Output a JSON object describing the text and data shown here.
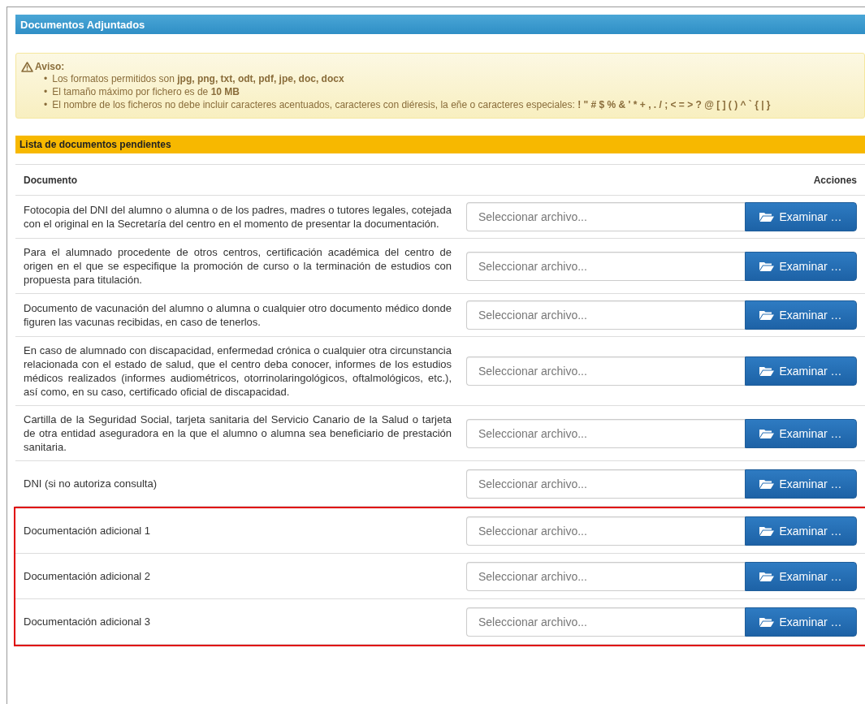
{
  "panel": {
    "title": "Documentos Adjuntados"
  },
  "notice": {
    "title": "Aviso:",
    "items": [
      {
        "bullet": "•",
        "text": "Los formatos permitidos son ",
        "emphasis": "jpg, png, txt, odt, pdf, jpe, doc, docx"
      },
      {
        "bullet": "•",
        "text": "El tamaño máximo por fichero es de ",
        "emphasis": "10 MB"
      },
      {
        "bullet": "•",
        "text": "El nombre de los ficheros no debe incluir caracteres acentuados, caracteres con diéresis, la eñe o caracteres especiales: ",
        "emphasis": "! \" # $ % & ' * + , . / ; < = > ? @ [ ] ( ) ^ ` { | }"
      }
    ]
  },
  "section": {
    "title": "Lista de documentos pendientes"
  },
  "table": {
    "columns": [
      "Documento",
      "Acciones"
    ],
    "rows": [
      {
        "document": "Fotocopia del DNI del alumno o alumna o de los padres, madres o tutores legales, cotejada con el original en la Secretaría del centro en el momento de presentar la documentación.",
        "placeholder": "Seleccionar archivo...",
        "button": "Examinar …",
        "highlighted": false
      },
      {
        "document": "Para el alumnado procedente de otros centros, certificación académica del centro de origen en el que se especifique la promoción de curso o la terminación de estudios con propuesta para titulación.",
        "placeholder": "Seleccionar archivo...",
        "button": "Examinar …",
        "highlighted": false
      },
      {
        "document": "Documento de vacunación del alumno o alumna o cualquier otro documento médico donde figuren las vacunas recibidas, en caso de tenerlos.",
        "placeholder": "Seleccionar archivo...",
        "button": "Examinar …",
        "highlighted": false
      },
      {
        "document": "En caso de alumnado con discapacidad, enfermedad crónica o cualquier otra circunstancia relacionada con el estado de salud, que el centro deba conocer, informes de los estudios médicos realizados (informes audiométricos, otorrinolaringológicos, oftalmológicos, etc.), así como, en su caso, certificado oficial de discapacidad.",
        "placeholder": "Seleccionar archivo...",
        "button": "Examinar …",
        "highlighted": false
      },
      {
        "document": "Cartilla de la Seguridad Social, tarjeta sanitaria del Servicio Canario de la Salud o tarjeta de otra entidad aseguradora en la que el alumno o alumna sea beneficiario de prestación sanitaria.",
        "placeholder": "Seleccionar archivo...",
        "button": "Examinar …",
        "highlighted": false
      },
      {
        "document": "DNI (si no autoriza consulta)",
        "placeholder": "Seleccionar archivo...",
        "button": "Examinar …",
        "highlighted": false
      },
      {
        "document": "Documentación adicional 1",
        "placeholder": "Seleccionar archivo...",
        "button": "Examinar …",
        "highlighted": true
      },
      {
        "document": "Documentación adicional 2",
        "placeholder": "Seleccionar archivo...",
        "button": "Examinar …",
        "highlighted": true
      },
      {
        "document": "Documentación adicional 3",
        "placeholder": "Seleccionar archivo...",
        "button": "Examinar …",
        "highlighted": true
      }
    ]
  }
}
